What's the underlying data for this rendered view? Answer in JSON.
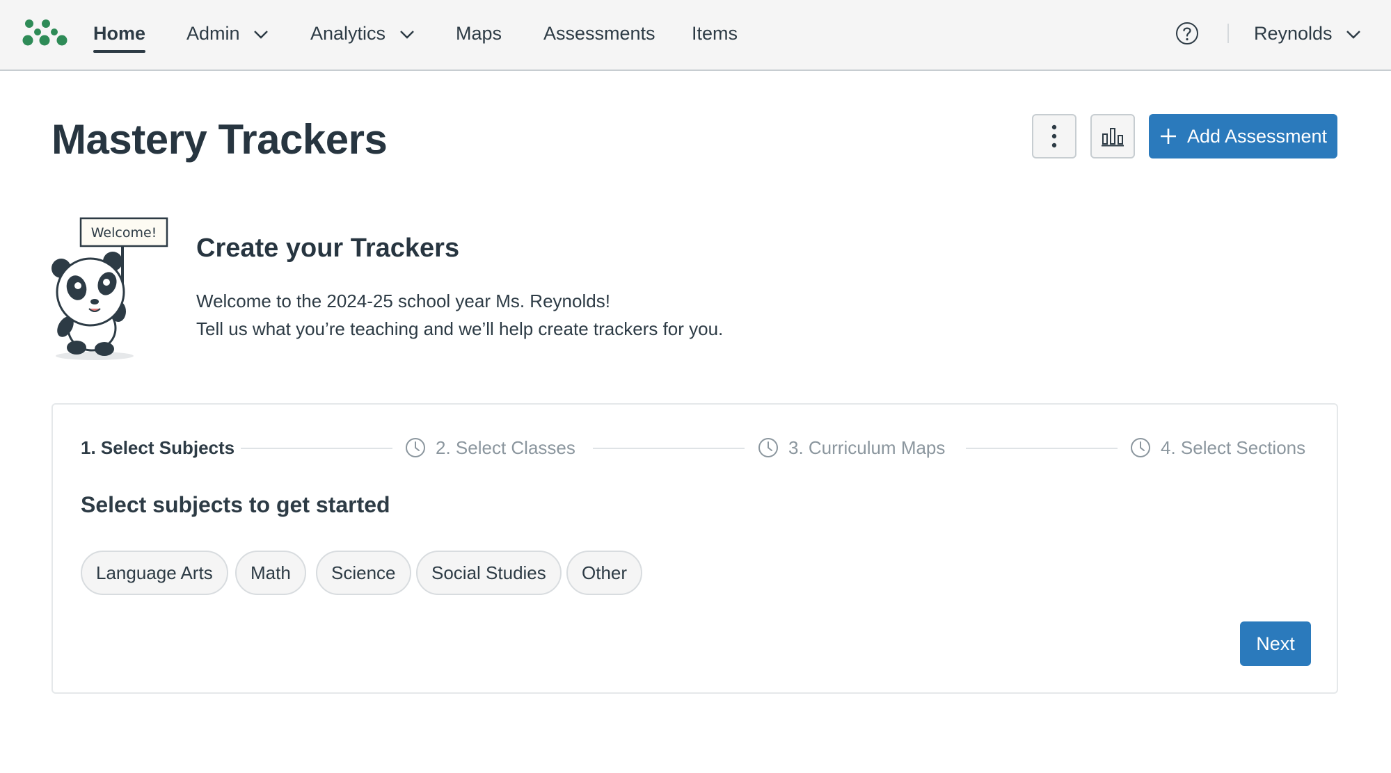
{
  "nav": {
    "logo_icon": "brand-dots-logo",
    "items": [
      {
        "label": "Home",
        "active": true
      },
      {
        "label": "Admin",
        "has_dropdown": true
      },
      {
        "label": "Analytics",
        "has_dropdown": true
      },
      {
        "label": "Maps"
      },
      {
        "label": "Assessments"
      },
      {
        "label": "Items"
      }
    ],
    "help_icon": "question-circle-icon",
    "user": {
      "name": "Reynolds",
      "has_dropdown": true
    }
  },
  "page": {
    "title": "Mastery Trackers",
    "actions": {
      "more_icon": "vertical-ellipsis-icon",
      "chart_icon": "bar-chart-icon",
      "add_label": "Add Assessment",
      "add_icon": "plus-icon"
    }
  },
  "welcome": {
    "sign_text": "Welcome!",
    "title": "Create your Trackers",
    "line1": "Welcome to the 2024-25 school year Ms. Reynolds!",
    "line2": "Tell us what you’re teaching and we’ll help create trackers for you."
  },
  "wizard": {
    "steps": [
      {
        "label": "1. Select Subjects",
        "state": "current"
      },
      {
        "label": "2.  Select Classes",
        "state": "pending"
      },
      {
        "label": "3. Curriculum Maps",
        "state": "pending"
      },
      {
        "label": "4. Select Sections",
        "state": "pending"
      }
    ],
    "section_title": "Select subjects to get started",
    "subjects": [
      "Language Arts",
      "Math",
      "Science",
      "Social Studies",
      "Other"
    ],
    "next_label": "Next"
  },
  "colors": {
    "brand_green": "#2e8b57",
    "primary_blue": "#2b7abc",
    "text_dark": "#2d3b45",
    "muted_gray": "#8b969e"
  }
}
